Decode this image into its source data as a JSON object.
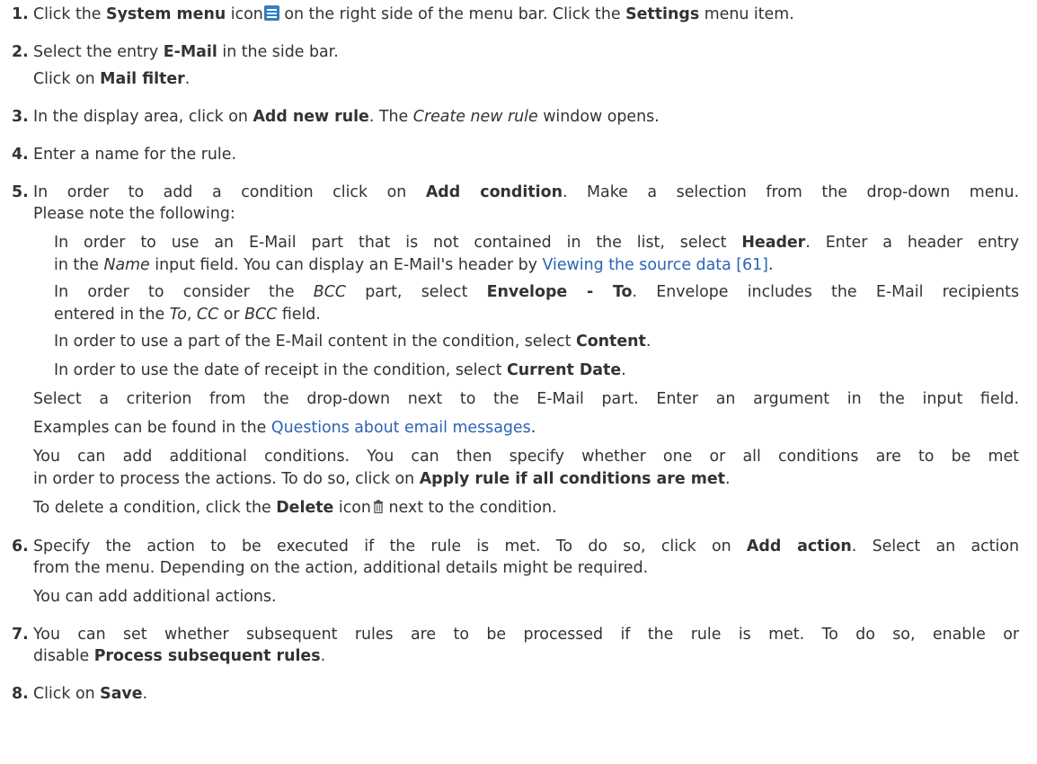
{
  "steps": {
    "s1": {
      "num": "1.",
      "a": "Click the ",
      "b": "System menu",
      "c": " icon",
      "d": " on the right side of the menu bar. Click the ",
      "e": "Settings",
      "f": " menu item."
    },
    "s2": {
      "num": "2.",
      "a": "Select the entry ",
      "b": "E-Mail",
      "c": " in the side bar.",
      "d": "Click on ",
      "e": "Mail filter",
      "f": "."
    },
    "s3": {
      "num": "3.",
      "a": "In the display area, click on ",
      "b": "Add new rule",
      "c": ". The ",
      "d": "Create new rule",
      "e": " window opens."
    },
    "s4": {
      "num": "4.",
      "a": "Enter a name for the rule."
    },
    "s5": {
      "num": "5.",
      "a": "In order to add a condition click on ",
      "b": "Add condition",
      "c": ". Make a selection from the drop-down menu.",
      "d": "Please note the following:",
      "n1a": "In order to use an E-Mail part that is not contained in the list, select ",
      "n1b": "Header",
      "n1c": ". Enter a header entry",
      "n1d": "in the ",
      "n1e": "Name",
      "n1f": " input field. You can display an E-Mail's header by ",
      "n1link": "Viewing the source data [61]",
      "n1g": ".",
      "n2a": "In order to consider the ",
      "n2b": "BCC",
      "n2c": " part, select ",
      "n2d": "Envelope - To",
      "n2e": ". Envelope includes the E-Mail recipients",
      "n2f": "entered in the ",
      "n2g": "To",
      "n2h": ", ",
      "n2i": "CC",
      "n2j": " or ",
      "n2k": "BCC",
      "n2l": " field.",
      "n3a": "In order to use a part of the E-Mail content in the condition, select ",
      "n3b": "Content",
      "n3c": ".",
      "n4a": "In order to use the date of receipt in the condition, select ",
      "n4b": "Current Date",
      "n4c": ".",
      "p1": "Select a criterion from the drop-down next to the E-Mail part. Enter an argument in the input field.",
      "p2a": "Examples can be found in the ",
      "p2link": "Questions about email messages",
      "p2b": ".",
      "p3a": "You can add additional conditions. You can then specify whether one or all conditions are to be met",
      "p3b": "in order to process the actions. To do so, click on ",
      "p3c": "Apply rule if all conditions are met",
      "p3d": ".",
      "p4a": "To delete a condition, click the ",
      "p4b": "Delete",
      "p4c": " icon",
      "p4d": " next to the condition."
    },
    "s6": {
      "num": "6.",
      "a": "Specify the action to be executed if the rule is met. To do so, click on ",
      "b": "Add action",
      "c": ". Select an action",
      "d": "from the menu. Depending on the action, additional details might be required.",
      "e": "You can add additional actions."
    },
    "s7": {
      "num": "7.",
      "a": "You can set whether subsequent rules are to be processed if the rule is met. To do so, enable or",
      "b": "disable ",
      "c": "Process subsequent rules",
      "d": "."
    },
    "s8": {
      "num": "8.",
      "a": "Click on ",
      "b": "Save",
      "c": "."
    }
  },
  "icons": {
    "system_menu": "hamburger-menu-icon",
    "delete": "trash-icon",
    "system_menu_color": "#2f7fc0",
    "link_color": "#2b63b5"
  }
}
